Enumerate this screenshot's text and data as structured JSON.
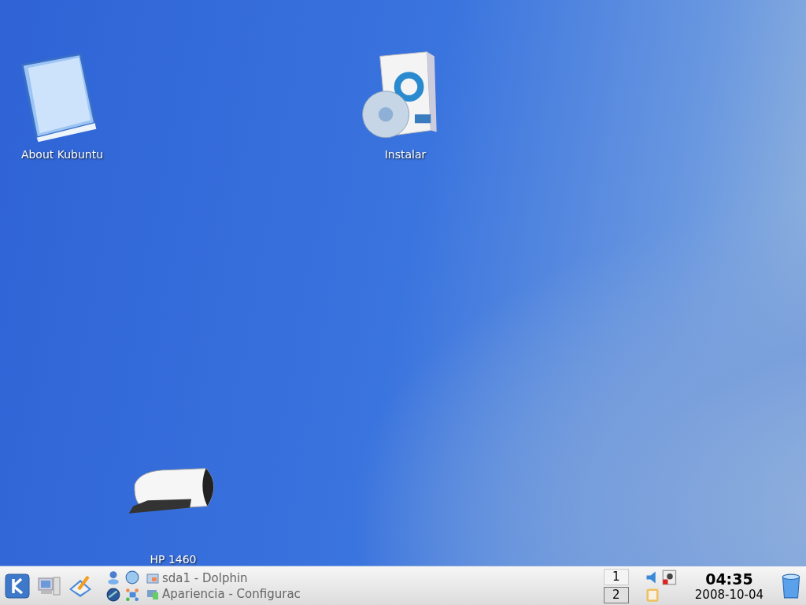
{
  "desktop_icons": [
    {
      "kind": "book",
      "label": "About Kubuntu"
    },
    {
      "kind": "installer",
      "label": "Instalar"
    },
    {
      "kind": "printer",
      "label": "HP 1460"
    }
  ],
  "taskbar": {
    "tasks": [
      {
        "kind": "folder",
        "title": "sda1 - Dolphin"
      },
      {
        "kind": "settings",
        "title": "Apariencia - Configurac"
      }
    ],
    "pager": [
      {
        "label": "1",
        "selected": false
      },
      {
        "label": "2",
        "selected": true
      }
    ],
    "clock": {
      "time": "04:35",
      "date": "2008-10-04"
    }
  }
}
